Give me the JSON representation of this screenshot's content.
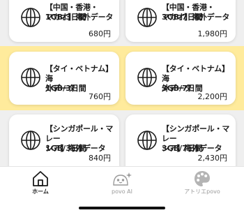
{
  "cards": [
    {
      "title": "【中国・香港・\nマカオ】海外データ",
      "plan": "1GB/3日間",
      "price": "680円"
    },
    {
      "title": "【中国・香港・\nマカオ】海外データ",
      "plan": "3GB/7日間",
      "price": "1,980円"
    },
    {
      "title": "【タイ・ベトナム】海\n外データ",
      "plan": "1GB/3日間",
      "price": "760円"
    },
    {
      "title": "【タイ・ベトナム】海\n外データ",
      "plan": "3GB/7日間",
      "price": "2,200円"
    },
    {
      "title": "【シンガポール・マレー\nシア】海外データ",
      "plan": "1GB/3日間",
      "price": "840円"
    },
    {
      "title": "【シンガポール・マレー\nシア】海外データ",
      "plan": "3GB/7日間",
      "price": "2,430円"
    }
  ],
  "tabs": [
    {
      "label": "ホーム",
      "icon": "home-icon",
      "active": true
    },
    {
      "label": "povo AI",
      "icon": "ai-face-icon",
      "active": false
    },
    {
      "label": "アトリエpovo",
      "icon": "palette-icon",
      "active": false
    }
  ],
  "colors": {
    "highlight": "#ffeb9c",
    "tab_inactive": "#9a9a9a"
  }
}
